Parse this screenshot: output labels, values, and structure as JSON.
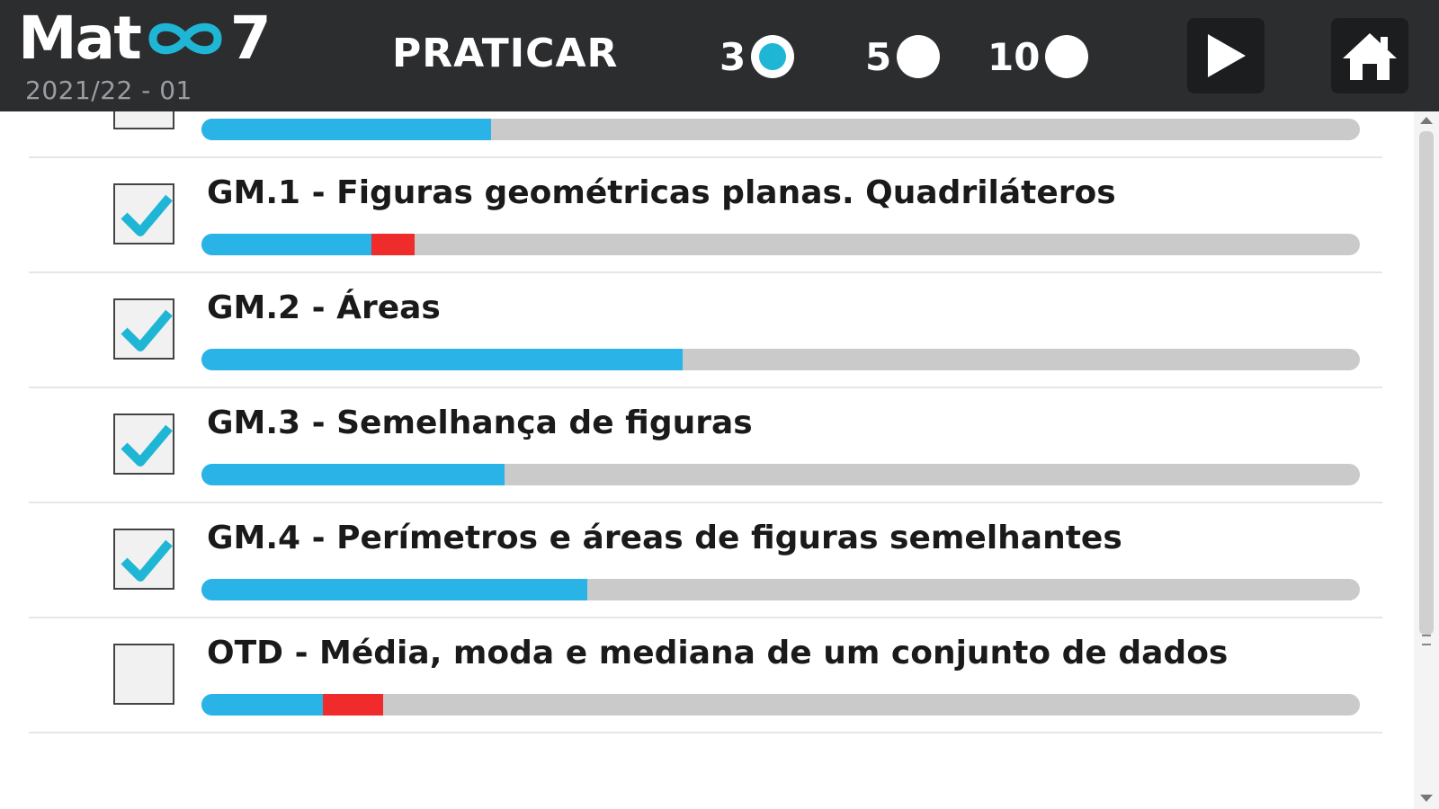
{
  "header": {
    "logo_left": "Mat",
    "logo_right": "7",
    "logo_icon": "infinity-icon",
    "subtitle": "2021/22 - 01",
    "mode_label": "PRATICAR",
    "counts": [
      {
        "label": "3",
        "selected": true
      },
      {
        "label": "5",
        "selected": false
      },
      {
        "label": "10",
        "selected": false
      }
    ],
    "play_icon": "play-icon",
    "home_icon": "home-icon",
    "accent_color": "#1fb6d6"
  },
  "topics": [
    {
      "title": "",
      "checked": false,
      "progress_blue": 0.25,
      "progress_red": 0.0
    },
    {
      "title": "GM.1 - Figuras geométricas planas. Quadriláteros",
      "checked": true,
      "progress_blue": 0.147,
      "progress_red": 0.037
    },
    {
      "title": "GM.2 - Áreas",
      "checked": true,
      "progress_blue": 0.415,
      "progress_red": 0.0
    },
    {
      "title": "GM.3 - Semelhança de figuras",
      "checked": true,
      "progress_blue": 0.262,
      "progress_red": 0.0
    },
    {
      "title": "GM.4 - Perímetros e áreas de figuras semelhantes",
      "checked": true,
      "progress_blue": 0.333,
      "progress_red": 0.0
    },
    {
      "title": "OTD - Média, moda e mediana de um conjunto de dados",
      "checked": false,
      "progress_blue": 0.105,
      "progress_red": 0.052
    }
  ],
  "colors": {
    "progress_blue": "#2ab3e6",
    "progress_red": "#ef2b2b",
    "checkmark": "#1fb6d6",
    "header_bg": "#2c2d2f"
  }
}
